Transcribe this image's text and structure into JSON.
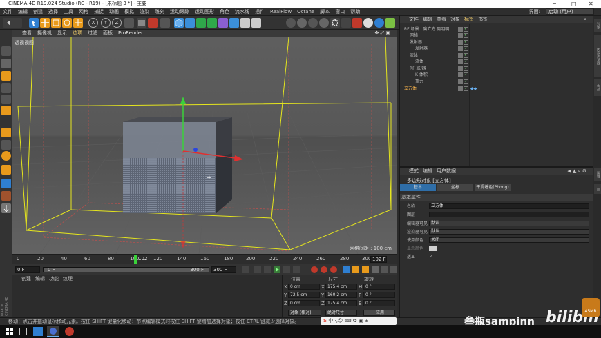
{
  "window": {
    "title": "CINEMA 4D R19.024 Studio (RC - R19) - [未标题 3 *] - 主要",
    "controls": [
      "─",
      "□",
      "✕"
    ]
  },
  "menubar": {
    "items": [
      "文件",
      "编辑",
      "创建",
      "选择",
      "工具",
      "网格",
      "捕捉",
      "动画",
      "模拟",
      "渲染",
      "雕刻",
      "运动跟踪",
      "运动图形",
      "角色",
      "流水线",
      "插件",
      "RealFlow",
      "Octane",
      "脚本",
      "窗口",
      "帮助"
    ],
    "layout_label": "界面:",
    "layout_value": "启动 (用户)"
  },
  "toolbar": {
    "xyz": [
      "X",
      "Y",
      "Z"
    ]
  },
  "viewport": {
    "menu": [
      "查看",
      "摄像机",
      "显示",
      "选项",
      "过滤",
      "面板",
      "ProRender"
    ],
    "label": "透视视图",
    "grid_spacing": "网格间距 : 100 cm"
  },
  "timeline": {
    "ticks": [
      "0",
      "20",
      "40",
      "60",
      "80",
      "100",
      "120",
      "140",
      "160",
      "180",
      "200",
      "220",
      "240",
      "260",
      "280",
      "300"
    ],
    "current_frame": "102",
    "frame_field": "102 F"
  },
  "transport": {
    "start": "0 F",
    "range_start": "0 F",
    "range_end": "300 F",
    "end": "300 F"
  },
  "material": {
    "menu": [
      "创建",
      "编辑",
      "功能",
      "纹理"
    ]
  },
  "coords": {
    "headers": [
      "位置",
      "尺寸",
      "旋转"
    ],
    "rows": [
      {
        "axis": "X",
        "pos": "0 cm",
        "size": "175.4 cm",
        "rot_axis": "H",
        "rot": "0 °"
      },
      {
        "axis": "Y",
        "pos": "72.5 cm",
        "size": "160.2 cm",
        "rot_axis": "P",
        "rot": "0 °"
      },
      {
        "axis": "Z",
        "pos": "0 cm",
        "size": "175.4 cm",
        "rot_axis": "B",
        "rot": "0 °"
      }
    ],
    "mode1": "对象 (相对)",
    "mode2": "绝对尺寸",
    "apply": "应用"
  },
  "objects": {
    "menu": [
      "文件",
      "编辑",
      "查看",
      "对象",
      "标签",
      "书签"
    ],
    "tree": [
      {
        "name": "RF 场景 | 魔立方.魔明明",
        "depth": 0
      },
      {
        "name": "网格",
        "depth": 1
      },
      {
        "name": "发射器",
        "depth": 1
      },
      {
        "name": "发射器",
        "depth": 2
      },
      {
        "name": "流体",
        "depth": 1
      },
      {
        "name": "流体",
        "depth": 2
      },
      {
        "name": "RF 减/器",
        "depth": 1
      },
      {
        "name": "K 体积",
        "depth": 2
      },
      {
        "name": "重力",
        "depth": 2
      },
      {
        "name": "立方体",
        "depth": 0,
        "selected": true
      }
    ]
  },
  "attributes": {
    "menu": [
      "模式",
      "编辑",
      "用户数据"
    ],
    "object_title": "多边形对象 [立方体]",
    "tabs": [
      "基本",
      "坐标",
      "平滑着色(Phong)"
    ],
    "section": "基本属性",
    "fields": [
      {
        "label": "名称",
        "value": "立方体"
      },
      {
        "label": "图层",
        "value": ""
      },
      {
        "label": "编辑器可见",
        "value": "默认"
      },
      {
        "label": "渲染器可见",
        "value": "默认"
      },
      {
        "label": "使用颜色",
        "value": "关闭"
      },
      {
        "label": "显示颜色",
        "value": ""
      },
      {
        "label": "透显",
        "value": "✓"
      }
    ]
  },
  "right_strip": [
    "对象",
    "内容浏览器",
    "构造",
    "属性",
    "层"
  ],
  "status": {
    "text": "移动：点击并拖动鼠标移动元素。按住 SHIFT 键量化移动；节点编辑模式时按住 SHIFT 键增加选择对象；按住 CTRL 键减少选择对象。"
  },
  "ime": {
    "label": "中"
  },
  "watermark": {
    "user": "叁瓶sampinn",
    "brand": "bilibili",
    "badge": "45MB"
  },
  "logo": {
    "brand": "MAXON",
    "product": "CINEMA 4D"
  },
  "colors": {
    "accent": "#2f7fd1",
    "selected": "#ffb84d",
    "bbox": "#e5e51e"
  }
}
